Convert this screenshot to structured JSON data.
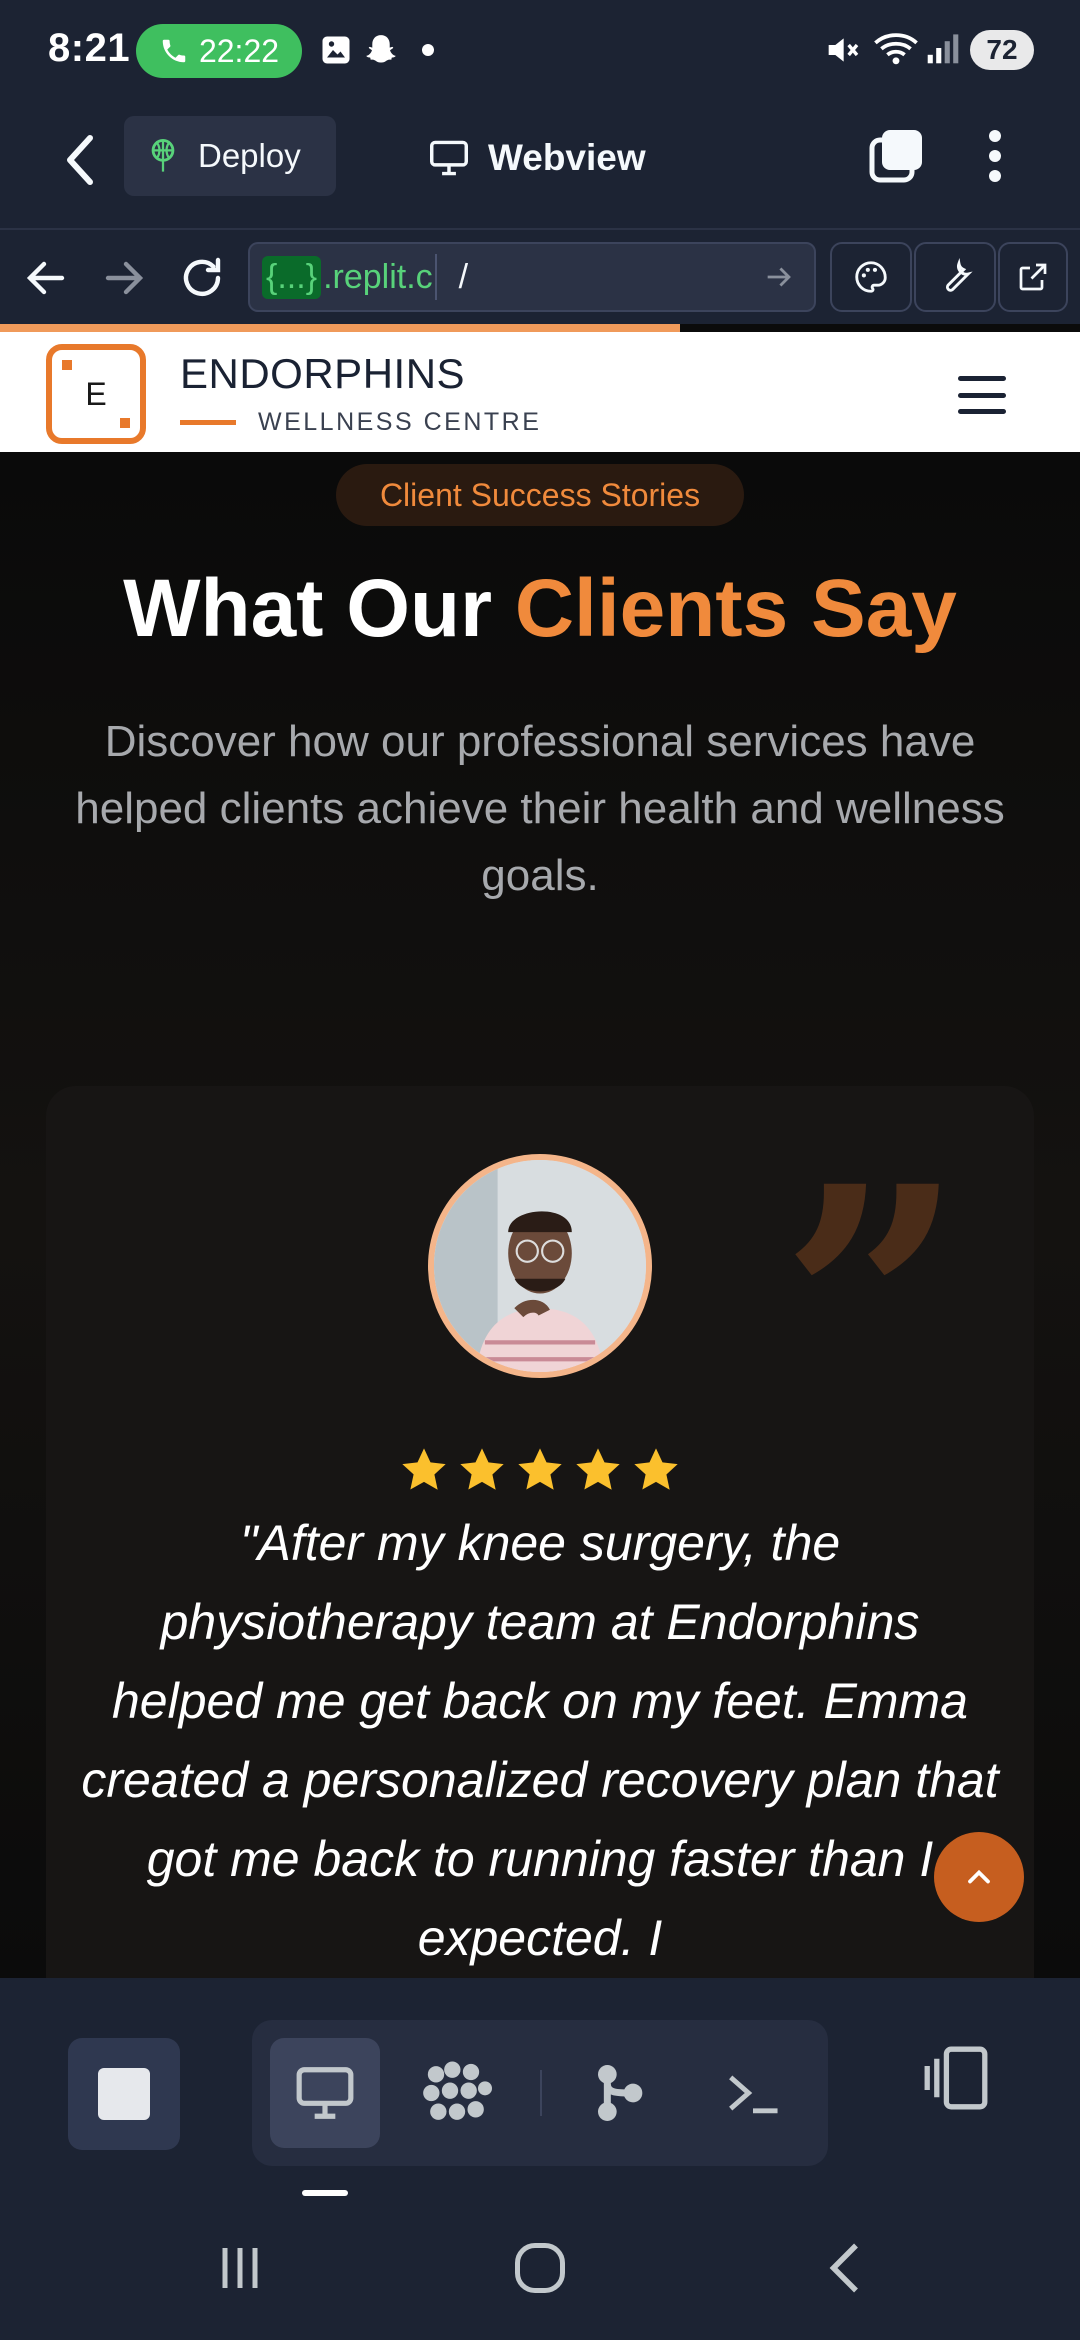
{
  "status_bar": {
    "time": "8:21",
    "call_duration": "22:22",
    "battery": "72"
  },
  "topbar": {
    "deploy_label": "Deploy",
    "webview_label": "Webview"
  },
  "urlbar": {
    "badge": "{...}",
    "host": ".replit.c",
    "path": "/"
  },
  "site": {
    "brand_initial": "E",
    "brand_name": "ENDORPHINS",
    "brand_sub": "WELLNESS CENTRE"
  },
  "section": {
    "pill": "Client Success Stories",
    "headline_part1": "What Our ",
    "headline_part2": "Clients Say",
    "subtext": "Discover how our professional services have helped clients achieve their health and wellness goals."
  },
  "testimonial": {
    "rating": 5,
    "quote": "\"After my knee surgery, the physiotherapy team at Endorphins helped me get back on my feet. Emma created a personalized recovery plan that got me back to running faster than I expected. I"
  },
  "colors": {
    "accent": "#f08a3c",
    "replit_bg": "#1c2333",
    "star": "#fbc02d",
    "url_green": "#58d27a"
  }
}
